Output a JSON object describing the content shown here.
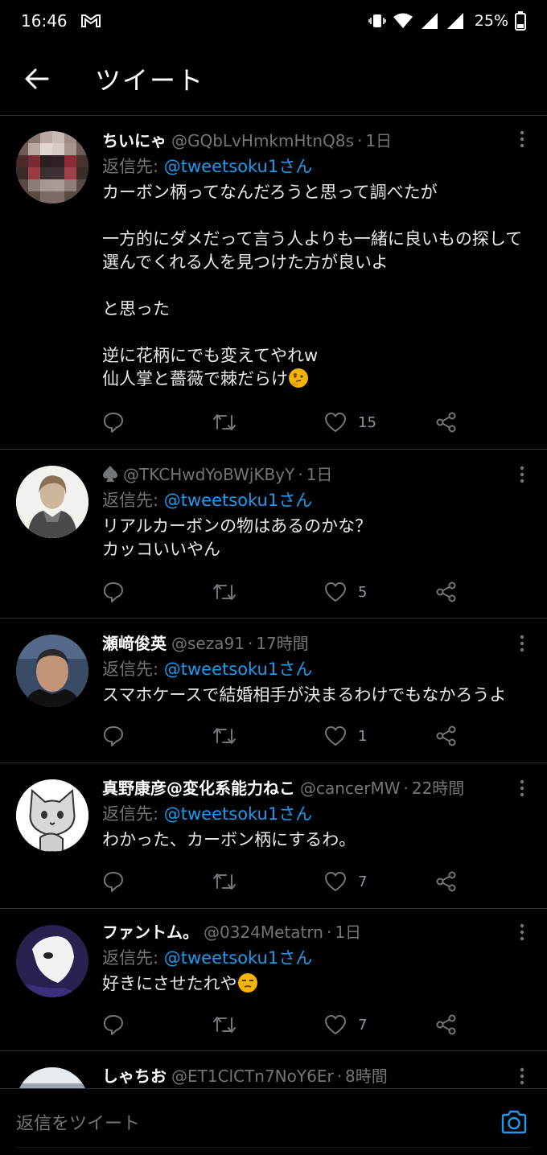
{
  "status_bar": {
    "time": "16:46",
    "battery": "25%"
  },
  "header": {
    "title": "ツイート"
  },
  "tweets": [
    {
      "name": "ちいにゃ",
      "handle": "@GQbLvHmkmHtnQ8s",
      "time": "1日",
      "reply_prefix": "返信先: ",
      "reply_mention": "@tweetsoku1さん",
      "body": "カーボン柄ってなんだろうと思って調べたが\n\n一方的にダメだって言う人よりも一緒に良いもの探して選んでくれる人を見つけた方が良いよ\n\nと思った\n\n逆に花柄にでも変えてやれw\n仙人掌と薔薇で棘だらけ",
      "emoji": "thinking-face-emoji",
      "likes": "15"
    },
    {
      "name": "",
      "name_icon": "spade-icon",
      "handle": "@TKCHwdYoBWjKByY",
      "time": "1日",
      "reply_prefix": "返信先: ",
      "reply_mention": "@tweetsoku1さん",
      "body": "リアルカーボンの物はあるのかな？\nカッコいいやん",
      "likes": "5"
    },
    {
      "name": "瀬﨑俊英",
      "handle": "@seza91",
      "time": "17時間",
      "reply_prefix": "返信先: ",
      "reply_mention": "@tweetsoku1さん",
      "body": "スマホケースで結婚相手が決まるわけでもなかろうよ",
      "likes": "1"
    },
    {
      "name": "真野康彦@変化系能力ねこ",
      "handle": "@cancerMW",
      "time": "22時間",
      "reply_prefix": "返信先: ",
      "reply_mention": "@tweetsoku1さん",
      "body": "わかった、カーボン柄にするわ。",
      "likes": "7"
    },
    {
      "name": "ファントム。",
      "handle": "@0324Metatrn",
      "time": "1日",
      "reply_prefix": "返信先: ",
      "reply_mention": "@tweetsoku1さん",
      "body": "好きにさせたれや",
      "emoji": "unamused-face-emoji",
      "likes": "7"
    },
    {
      "name": "しゃちお",
      "handle": "@ET1ClCTn7NoY6Er",
      "time": "8時間"
    }
  ],
  "composer": {
    "placeholder": "返信をツイート"
  },
  "colors": {
    "background": "#000000",
    "accent": "#1d9bf0",
    "muted": "#71767b",
    "divider": "#2f3336"
  }
}
